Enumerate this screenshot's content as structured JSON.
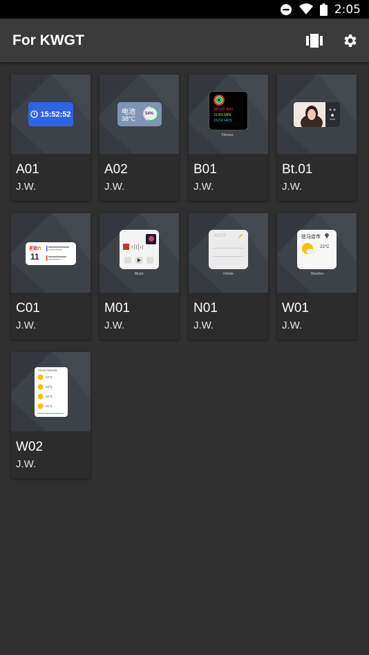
{
  "status_bar": {
    "time": "2:05",
    "icons": [
      "do-not-disturb-icon",
      "wifi-icon",
      "battery-icon"
    ]
  },
  "app_bar": {
    "title": "For KWGT",
    "actions": [
      "widgets-carousel-icon",
      "settings-gear-icon"
    ]
  },
  "widgets": [
    {
      "name": "A01",
      "author": "J.W.",
      "preview": {
        "time": "15:52:52"
      }
    },
    {
      "name": "A02",
      "author": "J.W.",
      "preview": {
        "label": "电池",
        "temp": "38°C",
        "percent": "54%"
      }
    },
    {
      "name": "B01",
      "author": "J.W.",
      "preview": {
        "line1": "58/100 BAT",
        "line2": "21/60 MIN",
        "line3": "15/24 HRS",
        "caption": "Fitness"
      }
    },
    {
      "name": "Bt.01",
      "author": "J.W.",
      "preview": {}
    },
    {
      "name": "C01",
      "author": "J.W.",
      "preview": {
        "weekday": "星期六",
        "day": "11"
      }
    },
    {
      "name": "M01",
      "author": "J.W.",
      "preview": {
        "caption": "Music"
      }
    },
    {
      "name": "N01",
      "author": "J.W.",
      "preview": {
        "header": "ACCS",
        "caption": "mNote"
      }
    },
    {
      "name": "W01",
      "author": "J.W.",
      "preview": {
        "city": "驻马店市",
        "temp": "23°C",
        "caption": "Weather"
      }
    },
    {
      "name": "W02",
      "author": "J.W.",
      "preview": {
        "header": "Clock reboots",
        "rows": [
          "22°C",
          "22°C",
          "22°C",
          "21°C"
        ]
      }
    }
  ],
  "colors": {
    "background": "#303030",
    "app_bar": "#3b3b3b",
    "card": "#2c2c2c",
    "thumb": "#3d4148",
    "accent_blue": "#2f63e6"
  }
}
